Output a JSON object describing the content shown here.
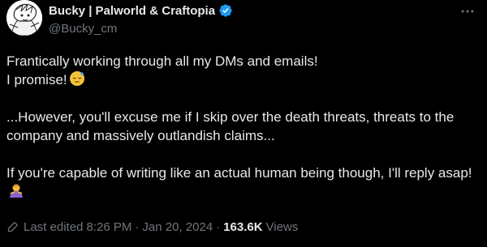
{
  "user": {
    "display_name": "Bucky | Palworld & Craftopia",
    "handle": "@Bucky_cm",
    "avatar_icon": "character-sketch-avatar",
    "verified_icon": "verified-badge-icon",
    "verified_color": "#1d9bf0"
  },
  "tweet": {
    "line1": "Frantically working through all my DMs and emails!",
    "line2": "I promise!",
    "line3": "...However, you'll excuse me if I skip over the death threats, threats to the company and massively outlandish claims...",
    "line4": "If you're capable of writing like an actual human being though, I'll reply asap!"
  },
  "meta": {
    "edited": "Last edited 8:26 PM",
    "date": "Jan 20, 2024",
    "dot": "·",
    "views_count": "163.6K",
    "views_label": "Views"
  },
  "colors": {
    "background": "#000000",
    "text": "#e7e9ea",
    "secondary": "#71767b"
  }
}
